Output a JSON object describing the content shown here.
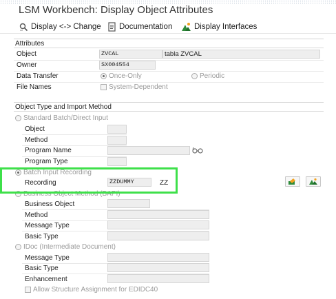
{
  "window": {
    "title": "LSM Workbench: Display Object Attributes"
  },
  "toolbar": {
    "display_change_label": "Display <-> Change",
    "documentation_label": "Documentation",
    "display_interfaces_label": "Display Interfaces"
  },
  "attributes": {
    "group_title": "Attributes",
    "object_label": "Object",
    "object_value": "ZVCAL",
    "object_description": "tabla ZVCAL",
    "owner_label": "Owner",
    "owner_value": "SX004554",
    "data_transfer_label": "Data Transfer",
    "once_only_label": "Once-Only",
    "periodic_label": "Periodic",
    "file_names_label": "File Names",
    "system_dependent_label": "System-Dependent"
  },
  "import_method": {
    "group_title": "Object Type and Import Method",
    "standard_batch": {
      "label": "Standard Batch/Direct Input",
      "object_label": "Object",
      "method_label": "Method",
      "program_name_label": "Program Name",
      "program_type_label": "Program Type"
    },
    "batch_input_recording": {
      "label": "Batch Input Recording",
      "recording_label": "Recording",
      "recording_value": "ZZDUMMY",
      "recording_suffix": "ZZ"
    },
    "bapi": {
      "label": "Business Object Method (BAPI)",
      "business_object_label": "Business Object",
      "method_label": "Method",
      "message_type_label": "Message Type",
      "basic_type_label": "Basic Type"
    },
    "idoc": {
      "label": "IDoc (Intermediate Document)",
      "message_type_label": "Message Type",
      "basic_type_label": "Basic Type",
      "enhancement_label": "Enhancement",
      "allow_structure_label": "Allow Structure Assignment for EDIDC40"
    }
  },
  "colors": {
    "highlight": "#3ee04a",
    "field_bg": "#eeeeee"
  }
}
